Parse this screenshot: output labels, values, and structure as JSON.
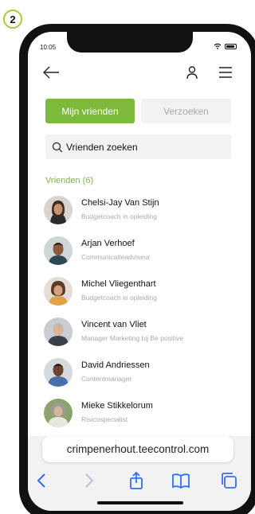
{
  "step": {
    "number": "2"
  },
  "status_bar": {
    "time": "10:05"
  },
  "tabs": {
    "active_label": "Mijn vrienden",
    "inactive_label": "Verzoeken"
  },
  "search": {
    "placeholder": "Vrienden zoeken"
  },
  "friends_section": {
    "title": "Vrienden (6)",
    "items": [
      {
        "name": "Chelsi-Jay Van Stijn",
        "role": "Budgetcoach in opleiding"
      },
      {
        "name": "Arjan Verhoef",
        "role": "Communicatieadviseur"
      },
      {
        "name": "Michel Vliegenthart",
        "role": "Budgetcoach in opleiding"
      },
      {
        "name": "Vincent van Vliet",
        "role": "Manager Marketing bij Be positive"
      },
      {
        "name": "David Andriessen",
        "role": "Contentmanager"
      },
      {
        "name": "Mieke Stikkelorum",
        "role": "Risicospecialist"
      }
    ]
  },
  "browser": {
    "url": "crimpenerhout.teecontrol.com"
  },
  "colors": {
    "accent": "#7db93c",
    "badge_border": "#a8c83a",
    "ios_blue": "#2f6ff6"
  }
}
